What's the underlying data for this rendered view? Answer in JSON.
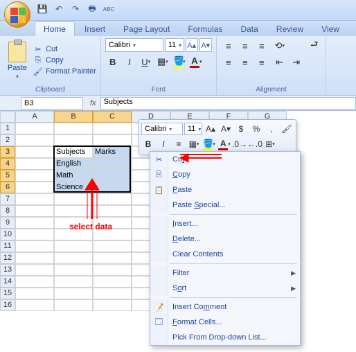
{
  "qat": {
    "save": "💾",
    "undo": "↶",
    "redo": "↷",
    "print": "🖶",
    "spell": "ABC"
  },
  "tabs": [
    "Home",
    "Insert",
    "Page Layout",
    "Formulas",
    "Data",
    "Review",
    "View"
  ],
  "active_tab": 0,
  "clipboard": {
    "paste_label": "Paste",
    "cut_label": "Cut",
    "copy_label": "Copy",
    "format_painter_label": "Format Painter",
    "group_label": "Clipboard"
  },
  "font": {
    "name": "Calibri",
    "size": "11",
    "group_label": "Font"
  },
  "alignment": {
    "group_label": "Alignment"
  },
  "formula_bar": {
    "cell_ref": "B3",
    "fx": "fx",
    "value": "Subjects"
  },
  "columns": [
    "A",
    "B",
    "C",
    "D",
    "E",
    "F",
    "G"
  ],
  "selected_cols": [
    "B",
    "C"
  ],
  "row_count": 16,
  "selected_rows": [
    3,
    4,
    5,
    6
  ],
  "cells": {
    "B3": "Subjects",
    "C3": "Marks",
    "B4": "English",
    "B5": "Math",
    "B6": "Science"
  },
  "annotations": {
    "select_data": "select data"
  },
  "mini": {
    "font": "Calibri",
    "size": "11"
  },
  "context_menu": {
    "items": [
      {
        "icon": "✂",
        "label": "Cut",
        "u": "t"
      },
      {
        "icon": "⎘",
        "label": "Copy",
        "u": "C"
      },
      {
        "icon": "📋",
        "label": "Paste",
        "u": "P"
      },
      {
        "icon": "",
        "label": "Paste Special...",
        "u": "S"
      },
      {
        "sep": true
      },
      {
        "icon": "",
        "label": "Insert...",
        "u": "I"
      },
      {
        "icon": "",
        "label": "Delete...",
        "u": "D"
      },
      {
        "icon": "",
        "label": "Clear Contents",
        "u": "N"
      },
      {
        "sep": true
      },
      {
        "icon": "",
        "label": "Filter",
        "u": "E",
        "sub": "▶"
      },
      {
        "icon": "",
        "label": "Sort",
        "u": "o",
        "sub": "▶"
      },
      {
        "sep": true
      },
      {
        "icon": "📝",
        "label": "Insert Comment",
        "u": "m"
      },
      {
        "icon": "🗔",
        "label": "Format Cells...",
        "u": "F"
      },
      {
        "icon": "",
        "label": "Pick From Drop-down List...",
        "u": "K"
      }
    ]
  }
}
